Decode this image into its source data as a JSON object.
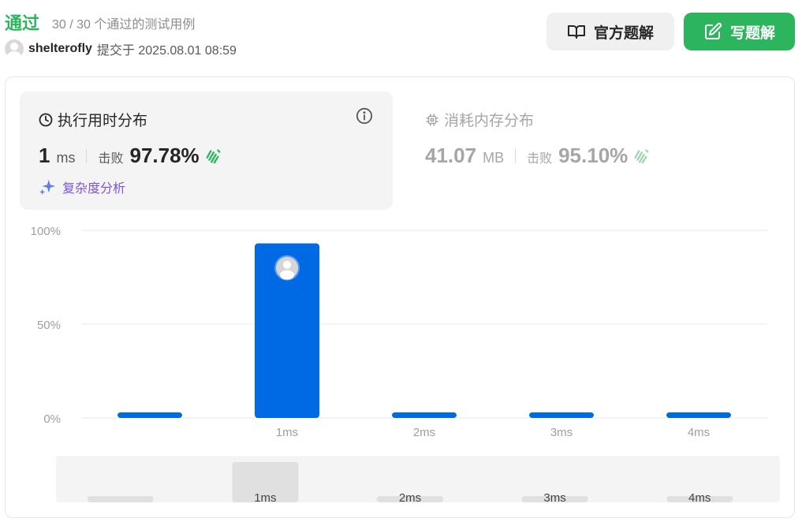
{
  "header": {
    "status": "通过",
    "case_count": "30 / 30 个通过的测试用例",
    "username": "shelterofly",
    "submitted_at": "提交于 2025.08.01 08:59",
    "official_solution_label": "官方题解",
    "write_solution_label": "写题解"
  },
  "runtime": {
    "title": "执行用时分布",
    "value": "1",
    "unit": "ms",
    "beat_label": "击败",
    "beat_value": "97.78%",
    "complexity_label": "复杂度分析"
  },
  "memory": {
    "title": "消耗内存分布",
    "value": "41.07",
    "unit": "MB",
    "beat_label": "击败",
    "beat_value": "95.10%"
  },
  "colors": {
    "accent_green": "#2db55d",
    "bar_blue": "#0069e4",
    "complexity_purple": "#7b55e0"
  },
  "chart_data": {
    "type": "bar",
    "categories": [
      "",
      "1ms",
      "2ms",
      "3ms",
      "4ms"
    ],
    "values": [
      3,
      93,
      3,
      3,
      3
    ],
    "y_ticks": [
      "0%",
      "50%",
      "100%"
    ],
    "ylim": [
      0,
      100
    ],
    "grid": true,
    "highlight_index": 1,
    "navigator": {
      "labels": [
        "",
        "1ms",
        "2ms",
        "3ms",
        "4ms"
      ],
      "values": [
        3,
        93,
        3,
        3,
        3
      ]
    }
  }
}
